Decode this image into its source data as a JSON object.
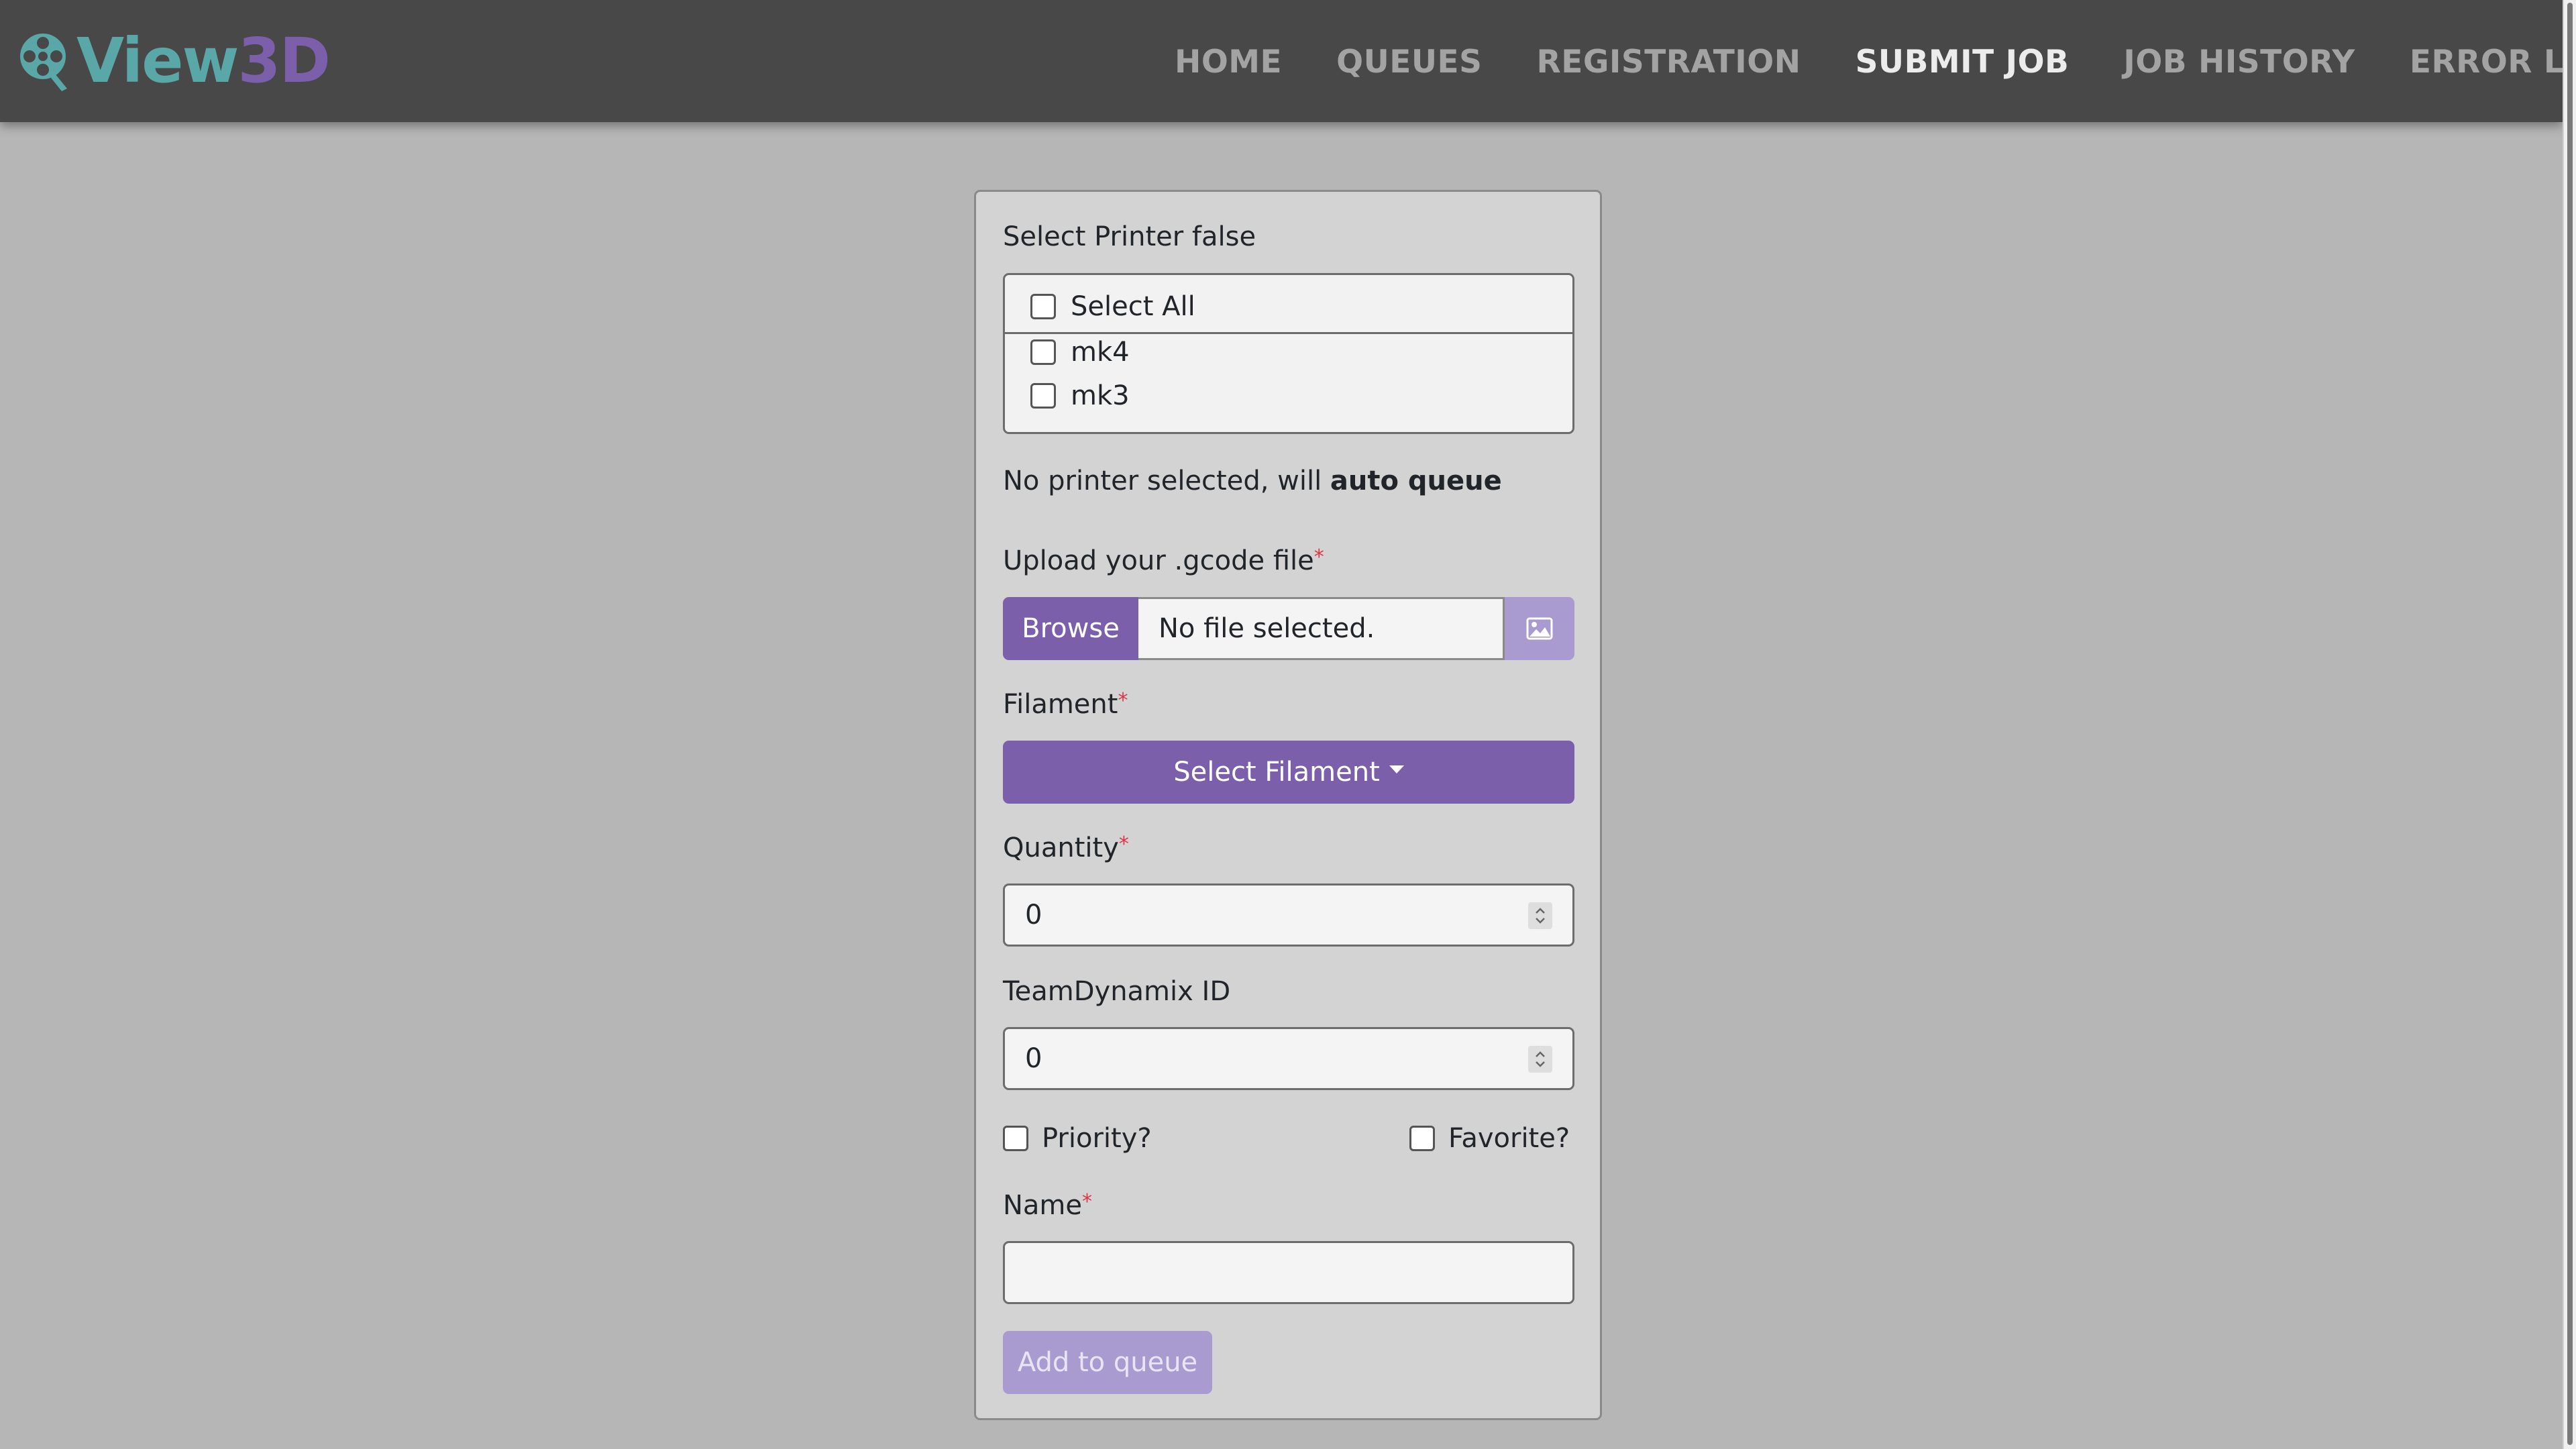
{
  "brand": {
    "part1": "View",
    "part2": "3D",
    "color_view": "#5aa7a7",
    "color_3d": "#7b5fab",
    "icon": "film-reel-magnifier-icon"
  },
  "nav": {
    "items": [
      {
        "label": "HOME",
        "active": false
      },
      {
        "label": "QUEUES",
        "active": false
      },
      {
        "label": "REGISTRATION",
        "active": false
      },
      {
        "label": "SUBMIT JOB",
        "active": true
      },
      {
        "label": "JOB HISTORY",
        "active": false
      },
      {
        "label": "ERROR LOG",
        "active": false
      }
    ]
  },
  "form": {
    "printer_label": "Select Printer false",
    "select_all_label": "Select All",
    "printers": [
      {
        "label": "mk4",
        "checked": false
      },
      {
        "label": "mk3",
        "checked": false
      }
    ],
    "status_prefix": "No printer selected, will ",
    "status_bold": "auto queue",
    "upload_label": "Upload your .gcode file",
    "required_mark": "*",
    "browse_label": "Browse",
    "file_name": "No file selected.",
    "image_button_icon": "image-icon",
    "filament_label": "Filament",
    "filament_button": "Select Filament",
    "quantity_label": "Quantity",
    "quantity_value": "0",
    "td_label": "TeamDynamix ID",
    "td_value": "0",
    "priority_label": "Priority?",
    "favorite_label": "Favorite?",
    "name_label": "Name",
    "name_value": "",
    "submit_label": "Add to queue"
  },
  "colors": {
    "accent": "#7b5fab",
    "accent_disabled": "#a99bd0",
    "navbar": "#484848",
    "page_bg": "#b6b6b6"
  }
}
